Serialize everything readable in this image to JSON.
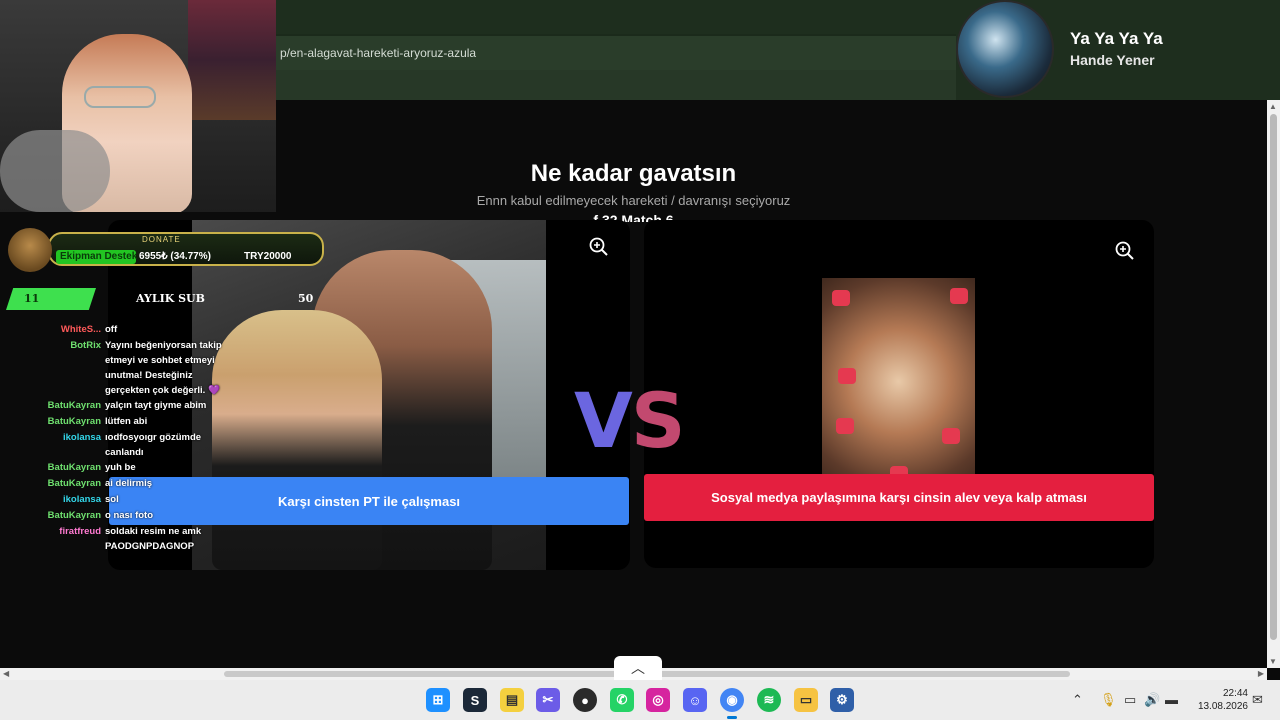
{
  "browser": {
    "url": "p/en-alagavat-hareketi-aryoruz-azula"
  },
  "page": {
    "title": "Ne kadar gavatsın",
    "subtitle": "Ennn kabul edilmeyecek hareketi / davranışı seçiyoruz",
    "match_label": "f 32 Match 6",
    "vs": {
      "v": "V",
      "s": "S"
    },
    "left_choice": "Karşı cinsten PT ile çalışması",
    "right_choice": "Sosyal medya paylaşımına karşı cinsin alev veya kalp atması"
  },
  "now_playing": {
    "title": "Ya Ya Ya Ya",
    "artist": "Hande Yener"
  },
  "donate": {
    "title": "DONATE",
    "label": "Ekipman Destek",
    "amount": "6955₺ (34.77%)",
    "goal": "TRY20000",
    "progress": 0.3477
  },
  "sub_goal": {
    "count": "11",
    "label": "AYLIK SUB",
    "target": "50"
  },
  "chat": [
    {
      "user": "WhiteS...",
      "color": "#ff5a5a",
      "msg": "off"
    },
    {
      "user": "BotRix",
      "color": "#6fe06f",
      "msg": "Yayını beğeniyorsan takip etmeyi ve sohbet etmeyi unutma! Desteğiniz gerçekten çok değerli. 💜"
    },
    {
      "user": "BatuKayran",
      "color": "#6fe06f",
      "msg": "yalçın tayt giyme abim"
    },
    {
      "user": "BatuKayran",
      "color": "#6fe06f",
      "msg": "lütfen abi"
    },
    {
      "user": "ikolansa",
      "color": "#33d6e8",
      "msg": "ıodfosyoıgr gözümde canlandı"
    },
    {
      "user": "BatuKayran",
      "color": "#6fe06f",
      "msg": "yuh be"
    },
    {
      "user": "BatuKayran",
      "color": "#6fe06f",
      "msg": "ai delirmiş"
    },
    {
      "user": "ikolansa",
      "color": "#33d6e8",
      "msg": "sol"
    },
    {
      "user": "BatuKayran",
      "color": "#6fe06f",
      "msg": "o nası foto"
    },
    {
      "user": "firatfreud",
      "color": "#ff7ad1",
      "msg": "soldaki resim ne amk PAODGNPDAGNOP"
    }
  ],
  "taskbar": {
    "time": "22:44",
    "date": "13.08.2026",
    "apps": [
      "windows-start",
      "steam",
      "sticky-notes",
      "snipping-tool",
      "obs",
      "whatsapp",
      "instagram",
      "discord",
      "chrome",
      "spotify",
      "file-explorer",
      "settings"
    ]
  },
  "colors": {
    "left_button": "#3a84f4",
    "right_button": "#e41f3f",
    "vs_v": "#6b66e0",
    "vs_s": "#c2496f"
  }
}
